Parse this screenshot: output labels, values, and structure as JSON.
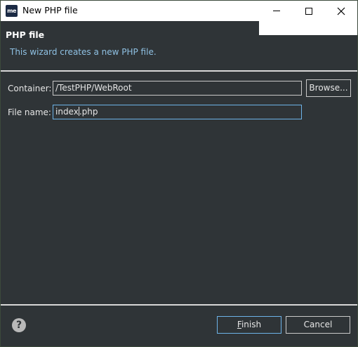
{
  "window": {
    "title": "New PHP file",
    "app_icon_text": "me"
  },
  "header": {
    "title": "PHP file",
    "description": "This wizard creates a new PHP file."
  },
  "form": {
    "container_label": "Container:",
    "container_value": "/TestPHP/WebRoot",
    "browse_label": "Browse...",
    "filename_label": "File name:",
    "filename_before_caret": "index",
    "filename_after_caret": ".php"
  },
  "footer": {
    "help_icon": "?",
    "finish_mnemonic": "F",
    "finish_rest": "inish",
    "cancel_label": "Cancel"
  },
  "icons": {
    "app": "myeclipse-logo-icon",
    "minimize": "minimize-icon",
    "maximize": "maximize-icon",
    "close": "close-icon",
    "help": "help-icon"
  },
  "colors": {
    "dialog_background": "#2f3437",
    "description_text": "#8fc1e3",
    "focus_border": "#6db3e8"
  }
}
